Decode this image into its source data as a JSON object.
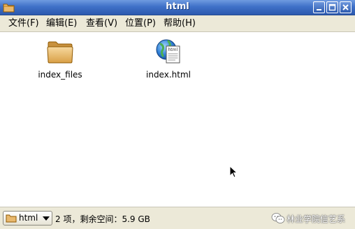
{
  "window": {
    "title": "html"
  },
  "menu": {
    "items": [
      {
        "label": "文件(F)"
      },
      {
        "label": "编辑(E)"
      },
      {
        "label": "查看(V)"
      },
      {
        "label": "位置(P)"
      },
      {
        "label": "帮助(H)"
      }
    ]
  },
  "files": [
    {
      "name": "index_files",
      "icon": "folder-icon"
    },
    {
      "name": "index.html",
      "icon": "html-document-icon",
      "badge": "html"
    }
  ],
  "statusbar": {
    "location": "html",
    "status": "2 项，剩余空间：5.9 GB"
  },
  "watermark": {
    "text": "林业学院信艺系"
  },
  "colors": {
    "titlebar": "#3f71c8",
    "menubar": "#ece9d8",
    "folder": "#e9b96e"
  }
}
